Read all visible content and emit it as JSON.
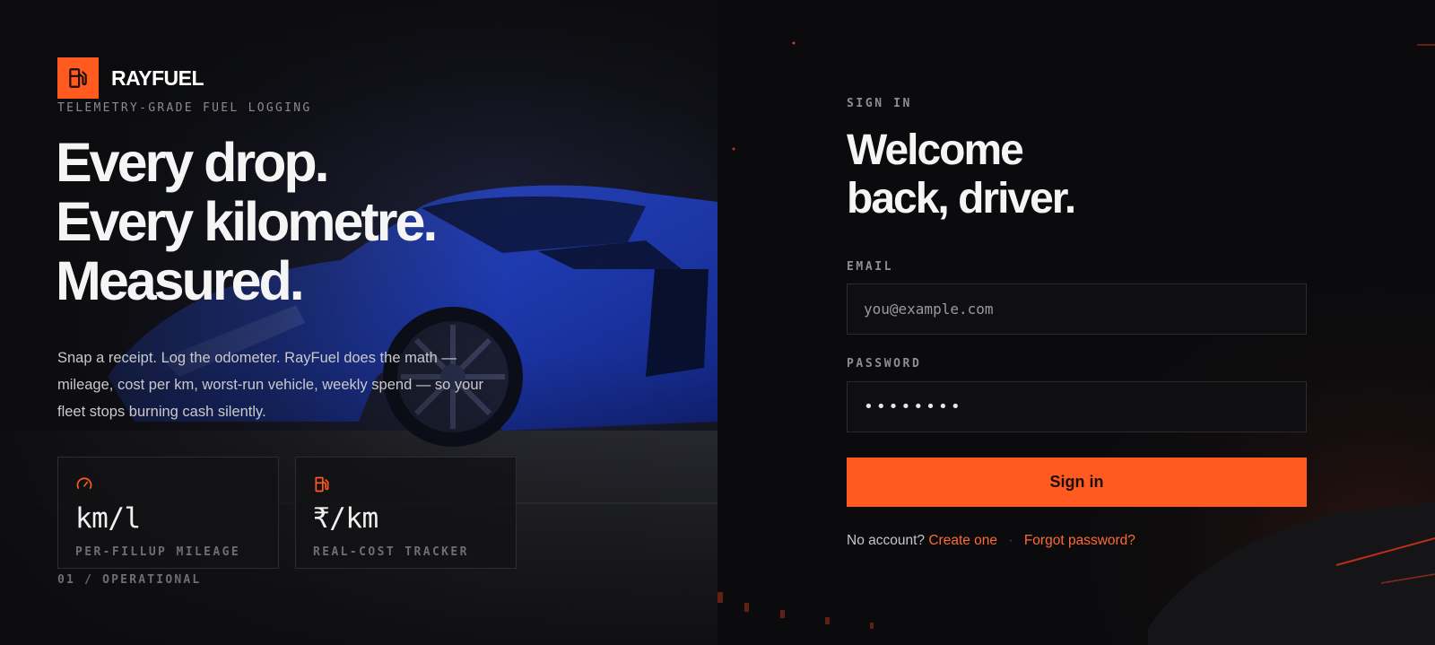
{
  "brand": {
    "name": "RAYFUEL",
    "tagline": "TELEMETRY-GRADE FUEL LOGGING"
  },
  "hero": {
    "headline": [
      "Every drop.",
      "Every kilometre.",
      "Measured."
    ],
    "description": "Snap a receipt. Log the odometer. RayFuel does the math — mileage, cost per km, worst-run vehicle, weekly spend — so your fleet stops burning cash silently."
  },
  "stats": [
    {
      "icon": "gauge-icon",
      "value": "km/l",
      "label": "PER-FILLUP MILEAGE"
    },
    {
      "icon": "fuel-pump-icon",
      "value": "₹/km",
      "label": "REAL-COST TRACKER"
    }
  ],
  "counter": "01 / OPERATIONAL",
  "signin": {
    "eyebrow": "SIGN IN",
    "title_line1": "Welcome",
    "title_line2": "back, driver.",
    "email_label": "EMAIL",
    "email_placeholder": "you@example.com",
    "password_label": "PASSWORD",
    "password_value": "••••••••",
    "submit_label": "Sign in",
    "no_account_text": "No account?",
    "create_link": "Create one",
    "separator": "·",
    "forgot_link": "Forgot password?"
  },
  "colors": {
    "accent": "#ff5a1f",
    "background": "#0b0b0d",
    "car": "#1f3fc2"
  }
}
